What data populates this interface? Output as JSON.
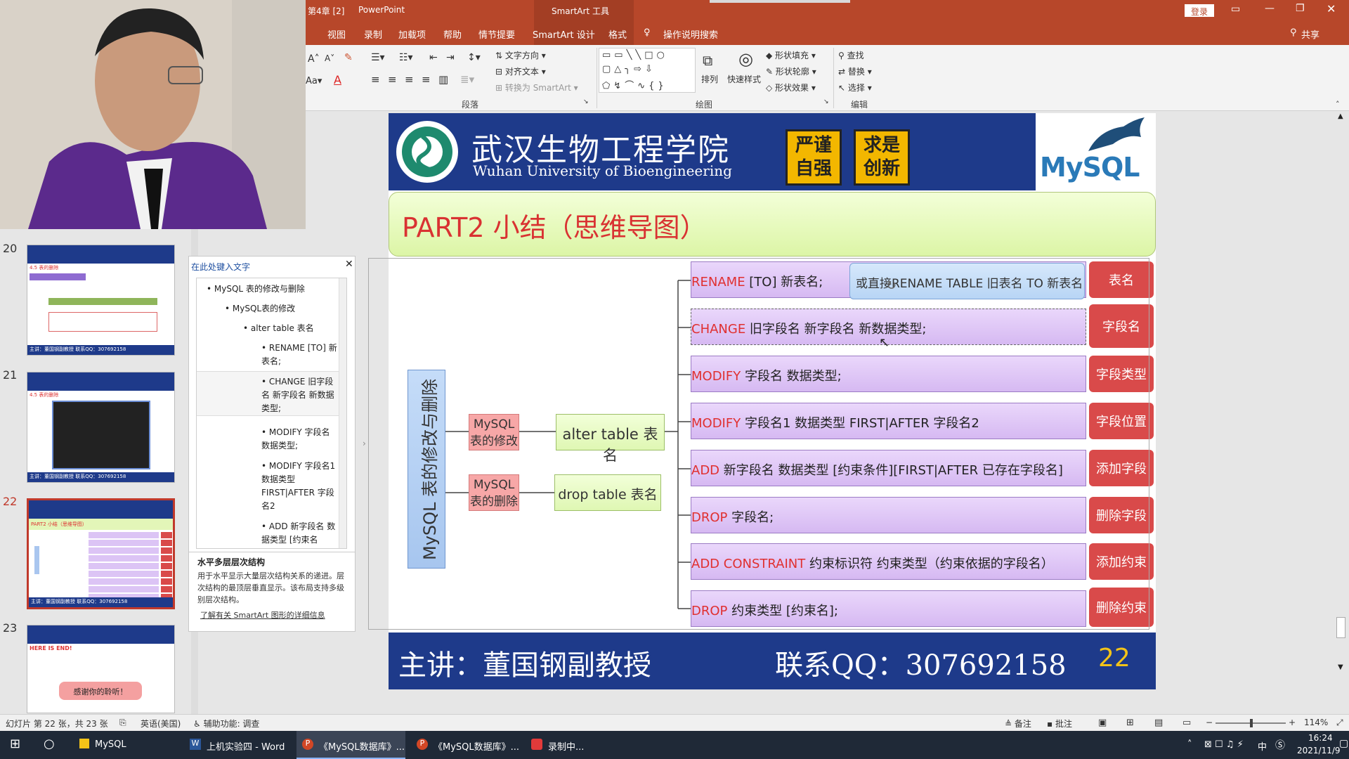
{
  "window": {
    "doc_title": "第4章 [2]",
    "app_name": "PowerPoint",
    "context_tab": "SmartArt 工具",
    "login": "登录"
  },
  "menu": {
    "items": [
      "视图",
      "录制",
      "加载项",
      "帮助",
      "情节提要",
      "SmartArt 设计",
      "格式"
    ],
    "tellme": "操作说明搜索",
    "share": "共享"
  },
  "ribbon": {
    "text_direction": "文字方向",
    "align_text": "对齐文本",
    "convert_smartart": "转换为 SmartArt",
    "paragraph_group": "段落",
    "arrange": "排列",
    "quick_styles": "快速样式",
    "shape_fill": "形状填充",
    "shape_outline": "形状轮廓",
    "shape_effects": "形状效果",
    "drawing_group": "绘图",
    "find": "查找",
    "replace": "替换",
    "select": "选择",
    "editing_group": "编辑"
  },
  "thumbnails": [
    {
      "num": "20",
      "tag": "4.5 表的删除",
      "footer": "主讲：董国钢副教授   联系QQ：307692158"
    },
    {
      "num": "21",
      "tag": "4.5 表的删除",
      "footer": "主讲：董国钢副教授   联系QQ：307692158"
    },
    {
      "num": "22",
      "tag": "PART2 小结（思维导图）",
      "footer": "主讲：董国钢副教授   联系QQ：307692158"
    },
    {
      "num": "23",
      "tag": "HERE IS END!",
      "closing": "感谢你的聆听！"
    }
  ],
  "textpane": {
    "title": "在此处键入文字",
    "items": [
      "MySQL 表的修改与删除",
      "MySQL表的修改",
      "alter table 表名",
      "RENAME [TO] 新表名;",
      "CHANGE 旧字段名 新字段名 新数据类型;",
      "MODIFY 字段名 数据类型;",
      "MODIFY 字段名1 数据类型 FIRST|AFTER 字段名2",
      "ADD 新字段名 数据类型 [约束名"
    ],
    "desc_title": "水平多层层次结构",
    "desc_body": "用于水平显示大量层次结构关系的递进。层次结构的最顶层垂直显示。该布局支持多级别层次结构。",
    "desc_link": "了解有关 SmartArt 图形的详细信息"
  },
  "slide": {
    "school_cn": "武汉生物工程学院",
    "school_en": "Wuhan University of Bioengineering",
    "motto1": "严谨自强",
    "motto2": "求是创新",
    "logo": "MySQL",
    "part_title": "PART2 小结（思维导图）",
    "root": "MySQL 表的修改与删除",
    "modify_node": "MySQL表的修改",
    "delete_node": "MySQL表的删除",
    "alter_node": "alter table 表名",
    "drop_node": "drop table 表名",
    "callout": "或直接RENAME TABLE 旧表名  TO 新表名",
    "rows": [
      {
        "kw": "RENAME",
        "rest": " [TO]  新表名;",
        "label": "表名"
      },
      {
        "kw": "CHANGE",
        "rest": " 旧字段名  新字段名 新数据类型;",
        "label": "字段名"
      },
      {
        "kw": "MODIFY",
        "rest": " 字段名  数据类型;",
        "label": "字段类型"
      },
      {
        "kw": "MODIFY",
        "rest": "  字段名1 数据类型 FIRST|AFTER 字段名2",
        "label": "字段位置"
      },
      {
        "kw": "ADD",
        "rest": "  新字段名  数据类型 [约束条件][FIRST|AFTER 已存在字段名]",
        "label": "添加字段"
      },
      {
        "kw": "DROP",
        "rest": " 字段名;",
        "label": "删除字段"
      },
      {
        "kw": "ADD  CONSTRAINT",
        "rest": "  约束标识符 约束类型（约束依据的字段名）",
        "label": "添加约束"
      },
      {
        "kw": "DROP",
        "rest": " 约束类型 [约束名];",
        "label": "删除约束"
      }
    ],
    "footer_speaker": "主讲：董国钢副教授",
    "footer_qq": "联系QQ：307692158",
    "page_num": "22"
  },
  "status": {
    "slide_info": "幻灯片 第 22 张，共 23 张",
    "language": "英语(美国)",
    "accessibility": "辅助功能: 调查",
    "notes": "备注",
    "comments": "批注",
    "zoom": "114%"
  },
  "taskbar": {
    "items": [
      "MySQL",
      "上机实验四 - Word",
      "《MySQL数据库》...",
      "《MySQL数据库》...",
      "录制中..."
    ],
    "time": "16:24",
    "date": "2021/11/9",
    "ime": "中"
  }
}
